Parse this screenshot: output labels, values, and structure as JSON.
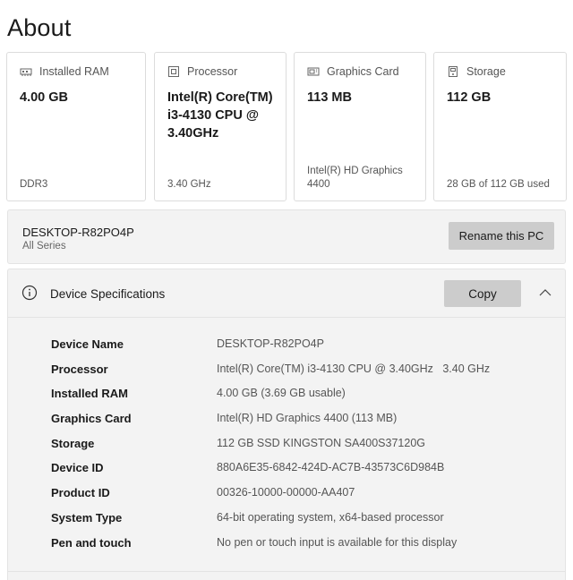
{
  "page": {
    "title": "About"
  },
  "cards": [
    {
      "icon": "ram-icon",
      "label": "Installed RAM",
      "value": "4.00 GB",
      "sub": "DDR3"
    },
    {
      "icon": "processor-icon",
      "label": "Processor",
      "value": "Intel(R) Core(TM) i3-4130 CPU @ 3.40GHz",
      "sub": "3.40 GHz"
    },
    {
      "icon": "graphics-card-icon",
      "label": "Graphics Card",
      "value": "113 MB",
      "sub": "Intel(R) HD Graphics 4400"
    },
    {
      "icon": "storage-icon",
      "label": "Storage",
      "value": "112 GB",
      "sub": "28 GB of 112 GB used"
    }
  ],
  "pc": {
    "name": "DESKTOP-R82PO4P",
    "series": "All Series",
    "rename_label": "Rename this PC"
  },
  "device_specs": {
    "title": "Device Specifications",
    "copy_label": "Copy",
    "rows": [
      {
        "key": "Device Name",
        "value": "DESKTOP-R82PO4P"
      },
      {
        "key": "Processor",
        "value": "Intel(R) Core(TM) i3-4130 CPU @ 3.40GHz   3.40 GHz"
      },
      {
        "key": "Installed RAM",
        "value": "4.00 GB (3.69 GB usable)"
      },
      {
        "key": "Graphics Card",
        "value": "Intel(R) HD Graphics 4400 (113 MB)"
      },
      {
        "key": "Storage",
        "value": "112 GB SSD KINGSTON SA400S37120G"
      },
      {
        "key": "Device ID",
        "value": "880A6E35-6842-424D-AC7B-43573C6D984B"
      },
      {
        "key": "Product ID",
        "value": "00326-10000-00000-AA407"
      },
      {
        "key": "System Type",
        "value": "64-bit operating system, x64-based processor"
      },
      {
        "key": "Pen and touch",
        "value": "No pen or touch input is available for this display"
      }
    ]
  }
}
